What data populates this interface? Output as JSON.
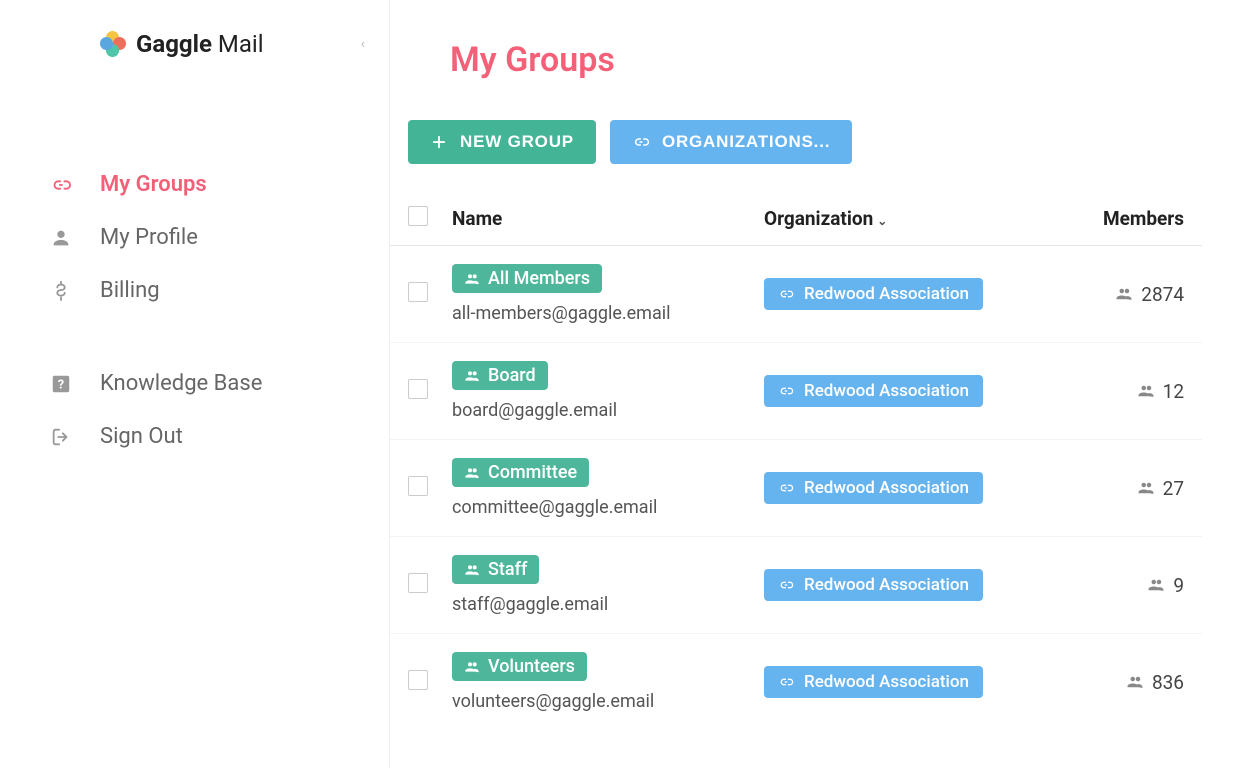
{
  "brand": {
    "strong": "Gaggle",
    "light": "Mail"
  },
  "sidebar": {
    "items": [
      {
        "label": "My Groups",
        "icon": "link",
        "active": true
      },
      {
        "label": "My Profile",
        "icon": "person",
        "active": false
      },
      {
        "label": "Billing",
        "icon": "dollar",
        "active": false
      }
    ],
    "secondary": [
      {
        "label": "Knowledge Base",
        "icon": "help"
      },
      {
        "label": "Sign Out",
        "icon": "signout"
      }
    ]
  },
  "page": {
    "title": "My Groups",
    "new_group": "NEW GROUP",
    "organizations": "ORGANIZATIONS..."
  },
  "table": {
    "headers": {
      "name": "Name",
      "organization": "Organization",
      "members": "Members"
    },
    "rows": [
      {
        "name": "All Members",
        "email": "all-members@gaggle.email",
        "org": "Redwood Association",
        "members": "2874"
      },
      {
        "name": "Board",
        "email": "board@gaggle.email",
        "org": "Redwood Association",
        "members": "12"
      },
      {
        "name": "Committee",
        "email": "committee@gaggle.email",
        "org": "Redwood Association",
        "members": "27"
      },
      {
        "name": "Staff",
        "email": "staff@gaggle.email",
        "org": "Redwood Association",
        "members": "9"
      },
      {
        "name": "Volunteers",
        "email": "volunteers@gaggle.email",
        "org": "Redwood Association",
        "members": "836"
      }
    ]
  }
}
